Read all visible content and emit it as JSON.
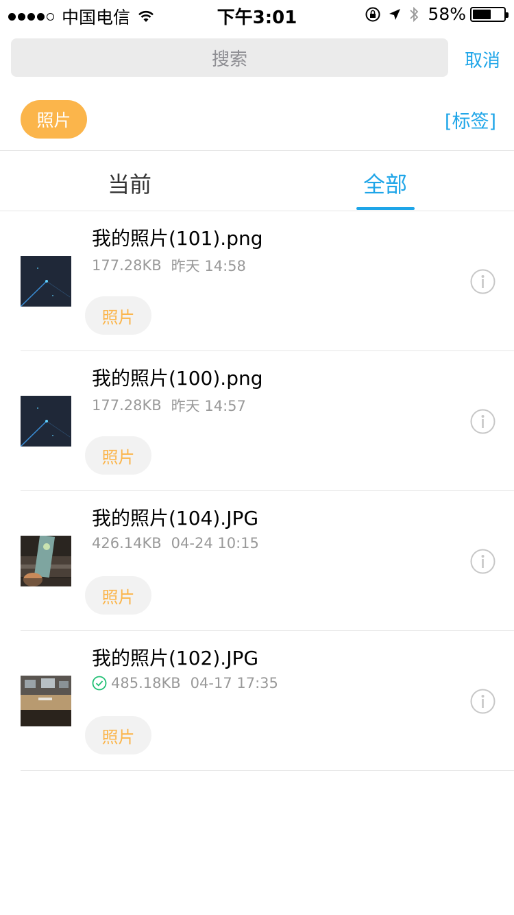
{
  "status_bar": {
    "carrier": "中国电信",
    "time": "下午3:01",
    "battery": "58%",
    "battery_level": 0.58
  },
  "search": {
    "placeholder": "搜索",
    "cancel_label": "取消"
  },
  "filter": {
    "active_chip": "照片",
    "tags_link": "[标签]"
  },
  "tabs": [
    {
      "label": "当前",
      "active": false
    },
    {
      "label": "全部",
      "active": true
    }
  ],
  "files": [
    {
      "name": "我的照片(101).png",
      "size": "177.28KB",
      "date": "昨天 14:58",
      "tag": "照片",
      "thumb": "dark-star",
      "synced": false
    },
    {
      "name": "我的照片(100).png",
      "size": "177.28KB",
      "date": "昨天 14:57",
      "tag": "照片",
      "thumb": "dark-star",
      "synced": false
    },
    {
      "name": "我的照片(104).JPG",
      "size": "426.14KB",
      "date": "04-24 10:15",
      "tag": "照片",
      "thumb": "photo-hand",
      "synced": false
    },
    {
      "name": "我的照片(102).JPG",
      "size": "485.18KB",
      "date": "04-17 17:35",
      "tag": "照片",
      "thumb": "photo-desk",
      "synced": true
    }
  ],
  "colors": {
    "accent": "#1ea5e8",
    "tag_orange": "#fbb54b",
    "synced_green": "#1fbf73"
  }
}
